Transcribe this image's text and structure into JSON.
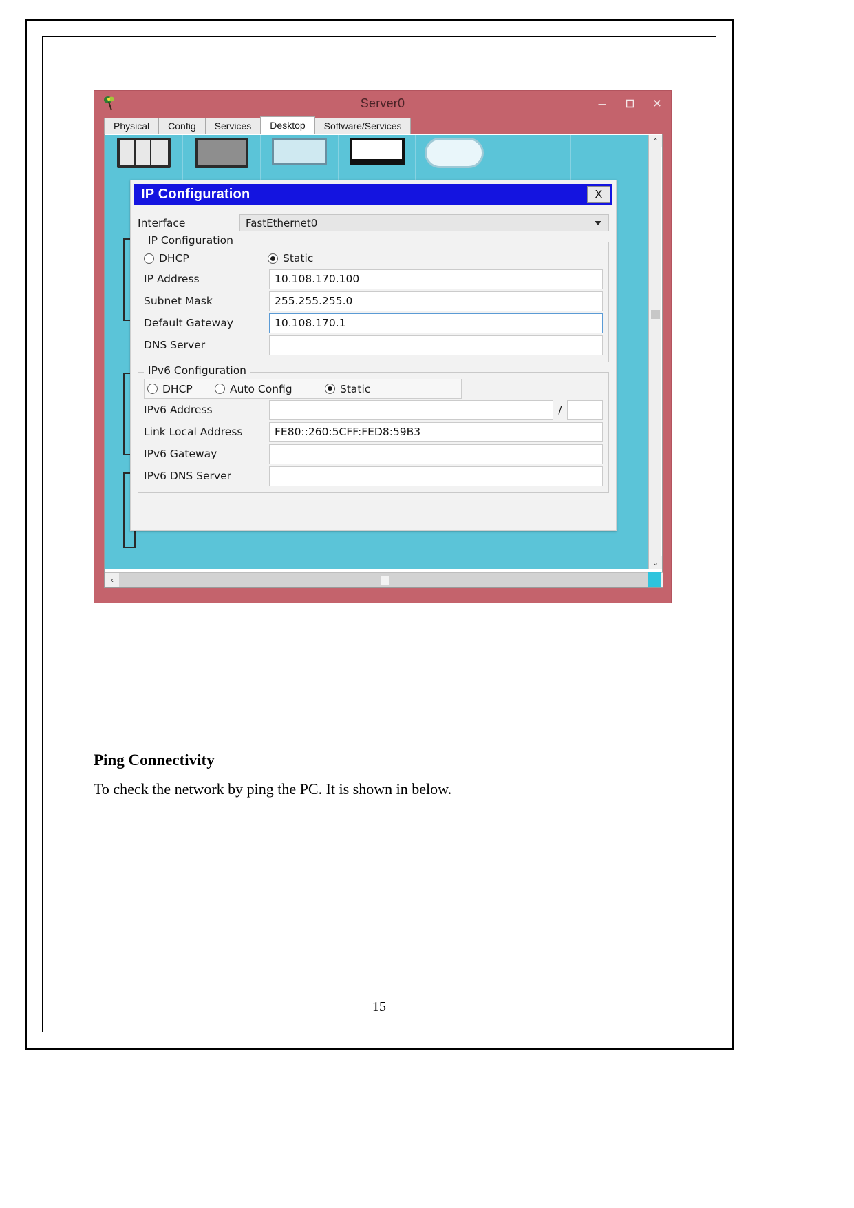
{
  "document": {
    "heading": "Ping Connectivity",
    "paragraph": "To check the network by ping the PC. It is shown in below.",
    "page_number": "15"
  },
  "window": {
    "title": "Server0",
    "icon": "packet-tracer-icon",
    "controls": {
      "minimize": "–",
      "maximize": "❐",
      "close": "×"
    },
    "tabs": [
      {
        "label": "Physical",
        "active": false
      },
      {
        "label": "Config",
        "active": false
      },
      {
        "label": "Services",
        "active": false
      },
      {
        "label": "Desktop",
        "active": true
      },
      {
        "label": "Software/Services",
        "active": false
      }
    ],
    "scrollbars": {
      "up_arrow": "⌃",
      "down_arrow": "⌄",
      "left_arrow": "‹",
      "right_arrow": "›"
    }
  },
  "dialog": {
    "title": "IP Configuration",
    "close_label": "X",
    "interface": {
      "label": "Interface",
      "value": "FastEthernet0",
      "caret": "chevron-down-icon"
    },
    "ipv4": {
      "legend": "IP Configuration",
      "modes": [
        {
          "label": "DHCP",
          "selected": false
        },
        {
          "label": "Static",
          "selected": true
        }
      ],
      "fields": [
        {
          "label": "IP Address",
          "value": "10.108.170.100",
          "focused": false
        },
        {
          "label": "Subnet Mask",
          "value": "255.255.255.0",
          "focused": false
        },
        {
          "label": "Default Gateway",
          "value": "10.108.170.1",
          "focused": true
        },
        {
          "label": "DNS Server",
          "value": "",
          "focused": false
        }
      ]
    },
    "ipv6": {
      "legend": "IPv6 Configuration",
      "modes": [
        {
          "label": "DHCP",
          "selected": false
        },
        {
          "label": "Auto Config",
          "selected": false
        },
        {
          "label": "Static",
          "selected": true
        }
      ],
      "address": {
        "label": "IPv6 Address",
        "value": "",
        "separator": "/",
        "prefix": ""
      },
      "fields": [
        {
          "label": "Link Local Address",
          "value": "FE80::260:5CFF:FED8:59B3"
        },
        {
          "label": "IPv6 Gateway",
          "value": ""
        },
        {
          "label": "IPv6 DNS Server",
          "value": ""
        }
      ]
    }
  },
  "colors": {
    "window_chrome": "#c4636c",
    "desktop_canvas": "#5bc4d8",
    "dialog_title": "#1414e0",
    "focus_border": "#5b9bd5"
  }
}
